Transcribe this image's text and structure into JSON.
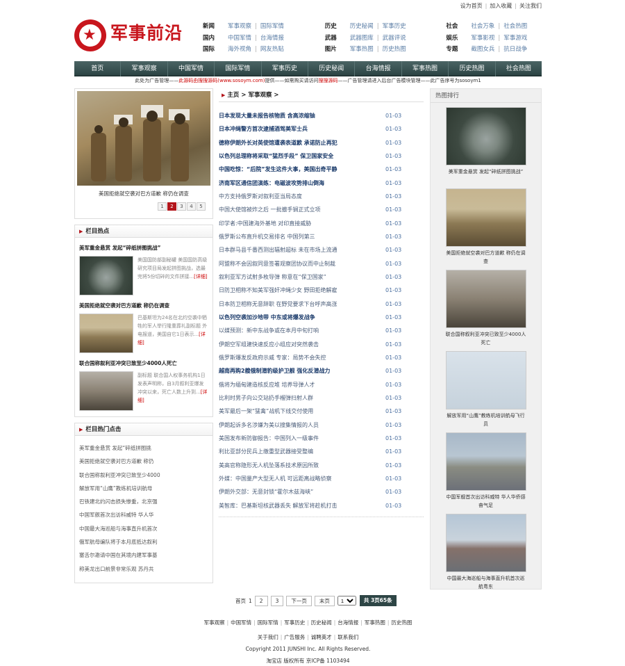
{
  "top_links": [
    "设为首页",
    "加入收藏",
    "关注我们"
  ],
  "site": {
    "name": "军事前沿"
  },
  "catnav": [
    [
      {
        "head": "新闻",
        "links": [
          "军事观察",
          "国际军情"
        ]
      },
      {
        "head": "历史",
        "links": [
          "历史秘闻",
          "军事历史"
        ]
      },
      {
        "head": "社会",
        "links": [
          "社会万象",
          "社会热图"
        ]
      }
    ],
    [
      {
        "head": "国内",
        "links": [
          "中国军情",
          "台海情报"
        ]
      },
      {
        "head": "武器",
        "links": [
          "武器图库",
          "武器评说"
        ]
      },
      {
        "head": "娱乐",
        "links": [
          "军事影视",
          "军事游戏"
        ]
      }
    ],
    [
      {
        "head": "国际",
        "links": [
          "海外视角",
          "网友热贴"
        ]
      },
      {
        "head": "图片",
        "links": [
          "军事热图",
          "历史热图"
        ]
      },
      {
        "head": "专题",
        "links": [
          "截图女兵",
          "抗日战争"
        ]
      }
    ]
  ],
  "main_nav": [
    "首页",
    "军事观察",
    "中国军情",
    "国际军情",
    "军事历史",
    "历史秘闻",
    "台海情报",
    "军事热图",
    "历史热图",
    "社会热图"
  ],
  "ad_line": {
    "pre": "此处为广告管理——",
    "red": "此源码由搜搜源码(www.sosoym.com)",
    "mid": "提供——如需购买请访问",
    "red2": "搜搜源码",
    "post": "——广告管理请进入后台广告模块管理——此广告序号为sosoym1"
  },
  "focus": {
    "caption": "美国拒绝就空袭对巴方道歉 称仍在调查",
    "pages": [
      "1",
      "2",
      "3",
      "4",
      "5"
    ],
    "active_page": "2"
  },
  "column_hot": {
    "title": "栏目热点",
    "items": [
      {
        "title": "美军重金悬赏 发起“碎纸拼图挑战”",
        "desc": "美国国防部副秘罐 美国国防高级研究项目局发起拼图挑战，选最完将5份切碎的文件拼接...",
        "more": "[详细]"
      },
      {
        "title": "美国拒绝就空袭对巴方道歉 称仍在调查",
        "desc": "巴基斯坦为24名在北约空袭中牺牲的军人举行隆重葬礼副标题 外电报道，美国自它1日表示...",
        "more": "[详细]"
      },
      {
        "title": "联合国称叙利亚冲突已致至少4000人死亡",
        "desc": "副标题 联合国人权事务机构1日发表声明称，自3月叙利亚爆发冲突以来，死亡人数上升到...",
        "more": "[详细]"
      }
    ]
  },
  "column_click": {
    "title": "栏目热门点击",
    "items": [
      "美军重金悬赏 发起“碎纸拼图挑",
      "美国拒绝就空袭对巴方道歉 称仍",
      "联合国称叙利亚冲突已致至少4000",
      "解放军用“山鹰”教练机培训航母",
      "巴铁建北约闪击损失惨重，北京强",
      "中国军舰首次出访科威特 华人华",
      "中国最大海巡船与海事直升机首次",
      "俄军航母编队将于本月底抵达叙利",
      "塞舌尔邀请中国在其境内建军事基",
      "称美龙出口前景非常乐观 苏丹共"
    ]
  },
  "breadcrumb": [
    "主页",
    "军事观察"
  ],
  "news": [
    {
      "title": "日本发现大量未报告核物质 含高浓缩铀",
      "date": "01-03",
      "bold": true
    },
    {
      "title": "日本冲绳警方首次逮捕酒驾美军士兵",
      "date": "01-03",
      "bold": true
    },
    {
      "title": "德称伊朗外长对英使馆遭袭表道歉 承诺防止再犯",
      "date": "01-03",
      "bold": true
    },
    {
      "title": "以色列总理称将采取“猛烈手段” 保卫国家安全",
      "date": "01-03",
      "bold": true
    },
    {
      "title": "中国吃惊：“后院”发生这件大事，美国出奇平静",
      "date": "01-03",
      "bold": true
    },
    {
      "title": "济南军区通信团演练：电磁波攻势排山倒海",
      "date": "01-03",
      "bold": true
    },
    {
      "title": "中方支持俄罗斯对叙利亚当局态度",
      "date": "01-03",
      "bold": false
    },
    {
      "title": "中国大使馆被炸之后 一批撤手锏正式立项",
      "date": "01-03",
      "bold": false
    },
    {
      "title": "印学者:中国建海外基地 对印直接威胁",
      "date": "01-03",
      "bold": false
    },
    {
      "title": "俄罗斯公布直升机交易排名 中国列第三",
      "date": "01-03",
      "bold": false
    },
    {
      "title": "日本群马县千番西测出辐射超标 未在市场上流通",
      "date": "01-03",
      "bold": false
    },
    {
      "title": "阿盟称不会因叙同意签署观察团协议而中止制裁",
      "date": "01-03",
      "bold": false
    },
    {
      "title": "叙利亚军方试射多枚导弹 称意在“保卫国家”",
      "date": "01-03",
      "bold": false
    },
    {
      "title": "日防卫相称不知美军强奸冲绳少女 野田拒绝解雇",
      "date": "01-03",
      "bold": false
    },
    {
      "title": "日本防卫相称无意辞职 在野党要求下台呼声高涨",
      "date": "01-03",
      "bold": false
    },
    {
      "title": "以色列空袭加沙地带 中东或将爆发战争",
      "date": "01-03",
      "bold": true
    },
    {
      "title": "以媒预测：新中东战争或在本月中旬打响",
      "date": "01-03",
      "bold": false
    },
    {
      "title": "伊朗空军组建快速反应小组应对突然袭击",
      "date": "01-03",
      "bold": false
    },
    {
      "title": "俄罗斯爆发反政府示威 专家：局势不会失控",
      "date": "01-03",
      "bold": false
    },
    {
      "title": "越南再购2艘俄制潜豹级护卫舰 强化反潜战力",
      "date": "01-03",
      "bold": true
    },
    {
      "title": "俄将为缅甸建造核反应堆 培养导弹人才",
      "date": "01-03",
      "bold": false
    },
    {
      "title": "比利时男子向公交站扔手榴弹扫射人群",
      "date": "01-03",
      "bold": false
    },
    {
      "title": "美军最后一架“猛禽”战机下线交付使用",
      "date": "01-03",
      "bold": false
    },
    {
      "title": "伊朗起诉多名涉嫌为美以搜集情报的人员",
      "date": "01-03",
      "bold": false
    },
    {
      "title": "美国发布新防御报告：中国列入一级事件",
      "date": "01-03",
      "bold": false
    },
    {
      "title": "利比亚部分民兵上缴重型武器接受整编",
      "date": "01-03",
      "bold": false
    },
    {
      "title": "美高官称隐形无人机坠落系技术原因所致",
      "date": "01-03",
      "bold": false
    },
    {
      "title": "外媒：中国量产大型无人机 可远距离战略侦察",
      "date": "01-03",
      "bold": false
    },
    {
      "title": "伊朗外交部：无意封锁“霍尔木兹海峡”",
      "date": "01-03",
      "bold": false
    },
    {
      "title": "美智库：巴基斯坦核武器丢失 解放军将趁机打击",
      "date": "01-03",
      "bold": false
    }
  ],
  "hot_rank": {
    "title": "热图排行",
    "items": [
      {
        "caption": "美军重金悬赏 发起“碎纸拼图挑战”",
        "scene": "pentagon"
      },
      {
        "caption": "美国拒绝就空袭对巴方道歉 称仍在调查",
        "scene": "soldiers"
      },
      {
        "caption": "联合国称叙利亚冲突已致至少4000人死亡",
        "scene": "crowd"
      },
      {
        "caption": "解放军用“山鹰”教练机培训航母飞行员",
        "scene": "jet"
      },
      {
        "caption": "中国军舰首次出访科威特 华人华侨感奋气足",
        "scene": "ship"
      },
      {
        "caption": "中国最大海巡船与海事直升机首次巡航粤东",
        "scene": "port"
      }
    ]
  },
  "pager": {
    "home": "首页",
    "current": "1",
    "pages": [
      "2",
      "3"
    ],
    "next": "下一页",
    "last": "末页",
    "select_value": "1",
    "total": "共 3页65条"
  },
  "footer": {
    "links": [
      "军事观察",
      "中国军情",
      "国际军情",
      "军事历史",
      "历史秘闻",
      "台海情报",
      "军事热图",
      "历史热图"
    ],
    "links2": [
      "关于我们",
      "广告服务",
      "诚聘英才",
      "联系我们"
    ],
    "copyright": "Copyright 2011 JUNSHI Inc. All Rights Reserved.",
    "icp": "淘宝店 版权所有 京ICP备 1103494"
  }
}
